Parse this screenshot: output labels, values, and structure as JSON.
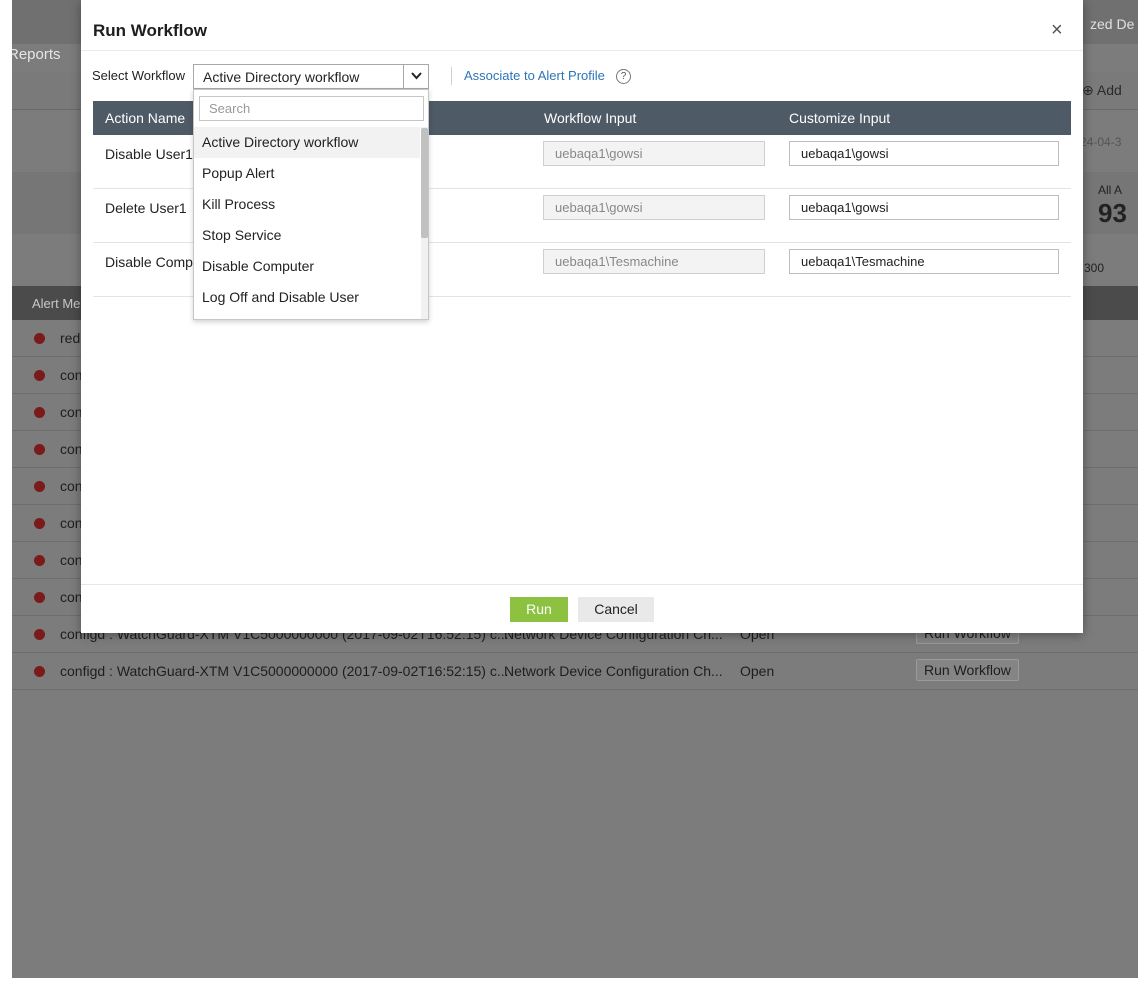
{
  "background": {
    "nav_reports": "Reports",
    "top_right_fragment": "zed De",
    "add_fragment": "Add",
    "date_fragment": "24-04-3",
    "all_alerts_fragment": "All A",
    "count_fragment": "93",
    "page_size_fragment": "300",
    "column_alert_message": "Alert Me",
    "rows": [
      {
        "message": "red",
        "type": "",
        "status": "",
        "action": ""
      },
      {
        "message": "con",
        "type": "",
        "status": "",
        "action": ""
      },
      {
        "message": "con",
        "type": "",
        "status": "",
        "action": ""
      },
      {
        "message": "con",
        "type": "",
        "status": "",
        "action": ""
      },
      {
        "message": "con",
        "type": "",
        "status": "",
        "action": ""
      },
      {
        "message": "con",
        "type": "",
        "status": "",
        "action": ""
      },
      {
        "message": "con",
        "type": "",
        "status": "",
        "action": ""
      },
      {
        "message": "con",
        "type": "",
        "status": "",
        "action": ""
      },
      {
        "message": "configd : WatchGuard-XTM V1C5000000000 (2017-09-02T16:52:15) c...",
        "type": "Network Device Configuration Ch...",
        "status": "Open",
        "action": "Run Workflow"
      },
      {
        "message": "configd : WatchGuard-XTM V1C5000000000 (2017-09-02T16:52:15) c...",
        "type": "Network Device Configuration Ch...",
        "status": "Open",
        "action": "Run Workflow"
      }
    ],
    "alert_dot_color": "#7a1a1a"
  },
  "modal": {
    "title": "Run Workflow",
    "close_label": "×",
    "select_label": "Select Workflow",
    "selected_workflow": "Active Directory workflow",
    "associate_link": "Associate to Alert Profile",
    "help_symbol": "?",
    "columns": {
      "action_name": "Action Name",
      "workflow_input": "Workflow Input",
      "customize_input": "Customize Input"
    },
    "rows": [
      {
        "action": "Disable User1",
        "workflow_input": "uebaqa1\\gowsi",
        "customize_input": "uebaqa1\\gowsi"
      },
      {
        "action": "Delete User1",
        "workflow_input": "uebaqa1\\gowsi",
        "customize_input": "uebaqa1\\gowsi"
      },
      {
        "action": "Disable Compu",
        "workflow_input": "uebaqa1\\Tesmachine",
        "customize_input": "uebaqa1\\Tesmachine"
      }
    ],
    "run_label": "Run",
    "cancel_label": "Cancel",
    "colors": {
      "run_button": "#8cc240",
      "table_header": "#4e5a65",
      "link": "#2e74b5"
    }
  },
  "dropdown": {
    "search_placeholder": "Search",
    "options": [
      "Active Directory workflow",
      "Popup Alert",
      "Kill Process",
      "Stop Service",
      "Disable Computer",
      "Log Off and Disable User"
    ],
    "selected_index": 0
  }
}
